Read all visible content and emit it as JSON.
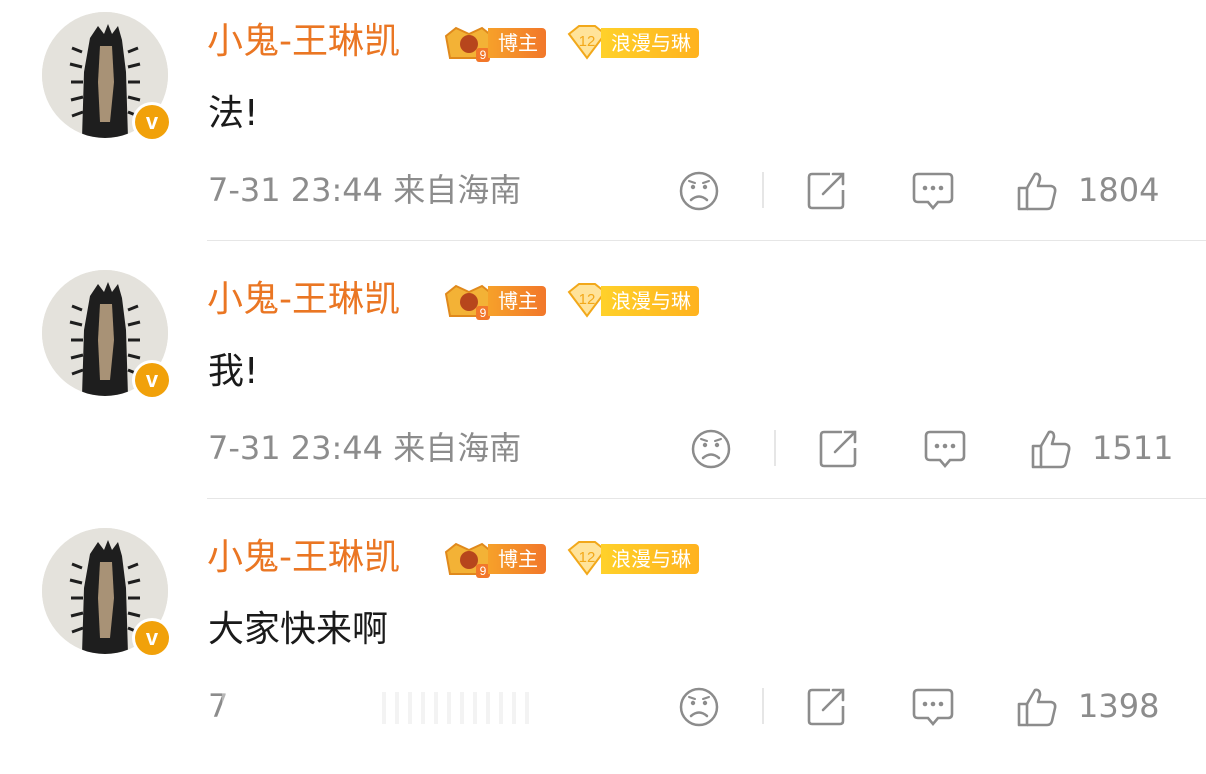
{
  "comments": [
    {
      "username": "小鬼-王琳凯",
      "rank_level": "9",
      "rank_label": "博主",
      "fan_level": "12",
      "fan_label": "浪漫与琳",
      "verified_mark": "v",
      "content": "法!",
      "time": "7-31 23:44",
      "location": "来自海南",
      "likes": "1804"
    },
    {
      "username": "小鬼-王琳凯",
      "rank_level": "9",
      "rank_label": "博主",
      "fan_level": "12",
      "fan_label": "浪漫与琳",
      "verified_mark": "v",
      "content": "我!",
      "time": "7-31 23:44",
      "location": "来自海南",
      "likes": "1511"
    },
    {
      "username": "小鬼-王琳凯",
      "rank_level": "9",
      "rank_label": "博主",
      "fan_level": "12",
      "fan_label": "浪漫与琳",
      "verified_mark": "v",
      "content": "大家快来啊",
      "time": "7",
      "likes": "1398"
    }
  ],
  "icons": {
    "dislike": "sad-face-icon",
    "repost": "share-icon",
    "comment": "comment-bubble-icon",
    "like": "thumbs-up-icon"
  },
  "colors": {
    "username": "#ea7623",
    "verified": "#f1a10a",
    "meta": "#8c8c8c"
  }
}
